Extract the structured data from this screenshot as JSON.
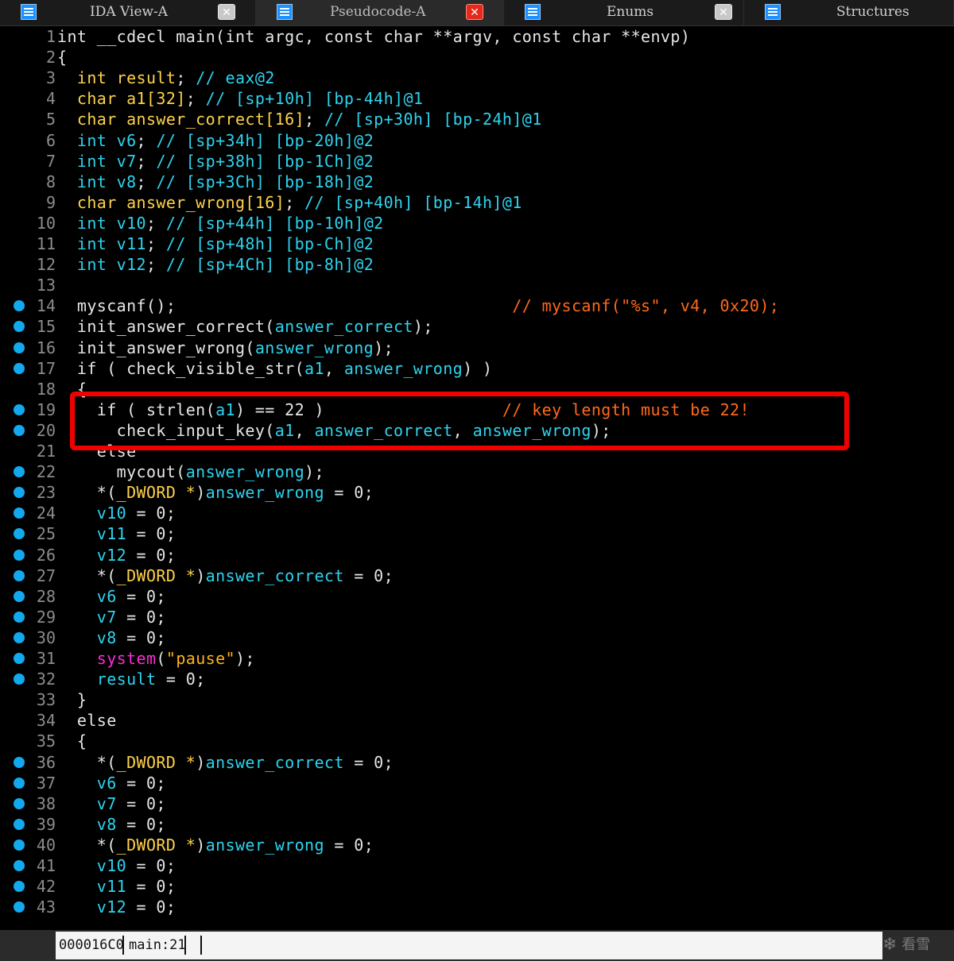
{
  "tabs": [
    {
      "label": "IDA View-A",
      "active": false,
      "close_style": "gray"
    },
    {
      "label": "Pseudocode-A",
      "active": true,
      "close_style": "red"
    },
    {
      "label": "Enums",
      "active": false,
      "close_style": "gray"
    },
    {
      "label": "Structures",
      "active": false,
      "close_style": "none"
    }
  ],
  "colors": {
    "plain": "#e6e6e6",
    "type": "#ffd24a",
    "variable": "#2ed3ef",
    "comment": "#ff6a1a",
    "system_call": "#ff2bd8",
    "string": "#ffb31a",
    "breakpoint_dot": "#13a9ee",
    "highlight_box": "#f20000"
  },
  "code_lines": [
    {
      "n": "1",
      "dot": false,
      "tokens": [
        [
          "kw",
          "int "
        ],
        [
          "plain",
          "__cdecl main("
        ],
        [
          "kw",
          "int "
        ],
        [
          "plain",
          "argc, "
        ],
        [
          "kw",
          "const char "
        ],
        [
          "plain",
          "**argv, "
        ],
        [
          "kw",
          "const char "
        ],
        [
          "plain",
          "**envp)"
        ]
      ]
    },
    {
      "n": "2",
      "dot": false,
      "tokens": [
        [
          "plain",
          "{"
        ]
      ]
    },
    {
      "n": "3",
      "dot": false,
      "tokens": [
        [
          "plain",
          "  "
        ],
        [
          "type",
          "int result"
        ],
        [
          "plain",
          "; "
        ],
        [
          "var",
          "// eax@2"
        ]
      ]
    },
    {
      "n": "4",
      "dot": false,
      "tokens": [
        [
          "plain",
          "  "
        ],
        [
          "type",
          "char a1[32]"
        ],
        [
          "plain",
          "; "
        ],
        [
          "var",
          "// [sp+10h] [bp-44h]@1"
        ]
      ]
    },
    {
      "n": "5",
      "dot": false,
      "tokens": [
        [
          "plain",
          "  "
        ],
        [
          "type",
          "char answer_correct[16]"
        ],
        [
          "plain",
          "; "
        ],
        [
          "var",
          "// [sp+30h] [bp-24h]@1"
        ]
      ]
    },
    {
      "n": "6",
      "dot": false,
      "tokens": [
        [
          "plain",
          "  "
        ],
        [
          "var",
          "int v6"
        ],
        [
          "plain",
          "; "
        ],
        [
          "var",
          "// [sp+34h] [bp-20h]@2"
        ]
      ]
    },
    {
      "n": "7",
      "dot": false,
      "tokens": [
        [
          "plain",
          "  "
        ],
        [
          "var",
          "int v7"
        ],
        [
          "plain",
          "; "
        ],
        [
          "var",
          "// [sp+38h] [bp-1Ch]@2"
        ]
      ]
    },
    {
      "n": "8",
      "dot": false,
      "tokens": [
        [
          "plain",
          "  "
        ],
        [
          "var",
          "int v8"
        ],
        [
          "plain",
          "; "
        ],
        [
          "var",
          "// [sp+3Ch] [bp-18h]@2"
        ]
      ]
    },
    {
      "n": "9",
      "dot": false,
      "tokens": [
        [
          "plain",
          "  "
        ],
        [
          "type",
          "char answer_wrong[16]"
        ],
        [
          "plain",
          "; "
        ],
        [
          "var",
          "// [sp+40h] [bp-14h]@1"
        ]
      ]
    },
    {
      "n": "10",
      "dot": false,
      "tokens": [
        [
          "plain",
          "  "
        ],
        [
          "var",
          "int v10"
        ],
        [
          "plain",
          "; "
        ],
        [
          "var",
          "// [sp+44h] [bp-10h]@2"
        ]
      ]
    },
    {
      "n": "11",
      "dot": false,
      "tokens": [
        [
          "plain",
          "  "
        ],
        [
          "var",
          "int v11"
        ],
        [
          "plain",
          "; "
        ],
        [
          "var",
          "// [sp+48h] [bp-Ch]@2"
        ]
      ]
    },
    {
      "n": "12",
      "dot": false,
      "tokens": [
        [
          "plain",
          "  "
        ],
        [
          "var",
          "int v12"
        ],
        [
          "plain",
          "; "
        ],
        [
          "var",
          "// [sp+4Ch] [bp-8h]@2"
        ]
      ]
    },
    {
      "n": "13",
      "dot": false,
      "tokens": []
    },
    {
      "n": "14",
      "dot": true,
      "tokens": [
        [
          "plain",
          "  myscanf();                                  "
        ],
        [
          "cm",
          "// myscanf(\"%s\", v4, 0x20);"
        ]
      ]
    },
    {
      "n": "15",
      "dot": true,
      "tokens": [
        [
          "plain",
          "  init_answer_correct("
        ],
        [
          "var",
          "answer_correct"
        ],
        [
          "plain",
          ");"
        ]
      ]
    },
    {
      "n": "16",
      "dot": true,
      "tokens": [
        [
          "plain",
          "  init_answer_wrong("
        ],
        [
          "var",
          "answer_wrong"
        ],
        [
          "plain",
          ");"
        ]
      ]
    },
    {
      "n": "17",
      "dot": true,
      "tokens": [
        [
          "plain",
          "  if ( check_visible_str("
        ],
        [
          "var",
          "a1"
        ],
        [
          "plain",
          ", "
        ],
        [
          "var",
          "answer_wrong"
        ],
        [
          "plain",
          ") )"
        ]
      ]
    },
    {
      "n": "18",
      "dot": false,
      "tokens": [
        [
          "plain",
          "  {"
        ]
      ]
    },
    {
      "n": "19",
      "dot": true,
      "tokens": [
        [
          "plain",
          "    if ( strlen("
        ],
        [
          "var",
          "a1"
        ],
        [
          "plain",
          ") == 22 )                  "
        ],
        [
          "cm",
          "// key length must be 22!"
        ]
      ]
    },
    {
      "n": "20",
      "dot": true,
      "tokens": [
        [
          "plain",
          "      check_input_key("
        ],
        [
          "var",
          "a1"
        ],
        [
          "plain",
          ", "
        ],
        [
          "var",
          "answer_correct"
        ],
        [
          "plain",
          ", "
        ],
        [
          "var",
          "answer_wrong"
        ],
        [
          "plain",
          ");"
        ]
      ]
    },
    {
      "n": "21",
      "dot": false,
      "tokens": [
        [
          "plain",
          "    else"
        ]
      ]
    },
    {
      "n": "22",
      "dot": true,
      "tokens": [
        [
          "plain",
          "      mycout("
        ],
        [
          "var",
          "answer_wrong"
        ],
        [
          "plain",
          ");"
        ]
      ]
    },
    {
      "n": "23",
      "dot": true,
      "tokens": [
        [
          "plain",
          "    *("
        ],
        [
          "type",
          "_DWORD *"
        ],
        [
          "plain",
          ")"
        ],
        [
          "var",
          "answer_wrong"
        ],
        [
          "plain",
          " = 0;"
        ]
      ]
    },
    {
      "n": "24",
      "dot": true,
      "tokens": [
        [
          "plain",
          "    "
        ],
        [
          "var",
          "v10"
        ],
        [
          "plain",
          " = 0;"
        ]
      ]
    },
    {
      "n": "25",
      "dot": true,
      "tokens": [
        [
          "plain",
          "    "
        ],
        [
          "var",
          "v11"
        ],
        [
          "plain",
          " = 0;"
        ]
      ]
    },
    {
      "n": "26",
      "dot": true,
      "tokens": [
        [
          "plain",
          "    "
        ],
        [
          "var",
          "v12"
        ],
        [
          "plain",
          " = 0;"
        ]
      ]
    },
    {
      "n": "27",
      "dot": true,
      "tokens": [
        [
          "plain",
          "    *("
        ],
        [
          "type",
          "_DWORD *"
        ],
        [
          "plain",
          ")"
        ],
        [
          "var",
          "answer_correct"
        ],
        [
          "plain",
          " = 0;"
        ]
      ]
    },
    {
      "n": "28",
      "dot": true,
      "tokens": [
        [
          "plain",
          "    "
        ],
        [
          "var",
          "v6"
        ],
        [
          "plain",
          " = 0;"
        ]
      ]
    },
    {
      "n": "29",
      "dot": true,
      "tokens": [
        [
          "plain",
          "    "
        ],
        [
          "var",
          "v7"
        ],
        [
          "plain",
          " = 0;"
        ]
      ]
    },
    {
      "n": "30",
      "dot": true,
      "tokens": [
        [
          "plain",
          "    "
        ],
        [
          "var",
          "v8"
        ],
        [
          "plain",
          " = 0;"
        ]
      ]
    },
    {
      "n": "31",
      "dot": true,
      "tokens": [
        [
          "plain",
          "    "
        ],
        [
          "sys",
          "system"
        ],
        [
          "plain",
          "("
        ],
        [
          "str",
          "\"pause\""
        ],
        [
          "plain",
          ");"
        ]
      ]
    },
    {
      "n": "32",
      "dot": true,
      "tokens": [
        [
          "plain",
          "    "
        ],
        [
          "var",
          "result"
        ],
        [
          "plain",
          " = 0;"
        ]
      ]
    },
    {
      "n": "33",
      "dot": false,
      "tokens": [
        [
          "plain",
          "  }"
        ]
      ]
    },
    {
      "n": "34",
      "dot": false,
      "tokens": [
        [
          "plain",
          "  else"
        ]
      ]
    },
    {
      "n": "35",
      "dot": false,
      "tokens": [
        [
          "plain",
          "  {"
        ]
      ]
    },
    {
      "n": "36",
      "dot": true,
      "tokens": [
        [
          "plain",
          "    *("
        ],
        [
          "type",
          "_DWORD *"
        ],
        [
          "plain",
          ")"
        ],
        [
          "var",
          "answer_correct"
        ],
        [
          "plain",
          " = 0;"
        ]
      ]
    },
    {
      "n": "37",
      "dot": true,
      "tokens": [
        [
          "plain",
          "    "
        ],
        [
          "var",
          "v6"
        ],
        [
          "plain",
          " = 0;"
        ]
      ]
    },
    {
      "n": "38",
      "dot": true,
      "tokens": [
        [
          "plain",
          "    "
        ],
        [
          "var",
          "v7"
        ],
        [
          "plain",
          " = 0;"
        ]
      ]
    },
    {
      "n": "39",
      "dot": true,
      "tokens": [
        [
          "plain",
          "    "
        ],
        [
          "var",
          "v8"
        ],
        [
          "plain",
          " = 0;"
        ]
      ]
    },
    {
      "n": "40",
      "dot": true,
      "tokens": [
        [
          "plain",
          "    *("
        ],
        [
          "type",
          "_DWORD *"
        ],
        [
          "plain",
          ")"
        ],
        [
          "var",
          "answer_wrong"
        ],
        [
          "plain",
          " = 0;"
        ]
      ]
    },
    {
      "n": "41",
      "dot": true,
      "tokens": [
        [
          "plain",
          "    "
        ],
        [
          "var",
          "v10"
        ],
        [
          "plain",
          " = 0;"
        ]
      ]
    },
    {
      "n": "42",
      "dot": true,
      "tokens": [
        [
          "plain",
          "    "
        ],
        [
          "var",
          "v11"
        ],
        [
          "plain",
          " = 0;"
        ]
      ]
    },
    {
      "n": "43",
      "dot": true,
      "tokens": [
        [
          "plain",
          "    "
        ],
        [
          "var",
          "v12"
        ],
        [
          "plain",
          " = 0;"
        ]
      ]
    }
  ],
  "status": {
    "address": "000016C0",
    "location": "main:21"
  },
  "watermark": {
    "text": "看雪",
    "icon": "snowflake-icon"
  }
}
